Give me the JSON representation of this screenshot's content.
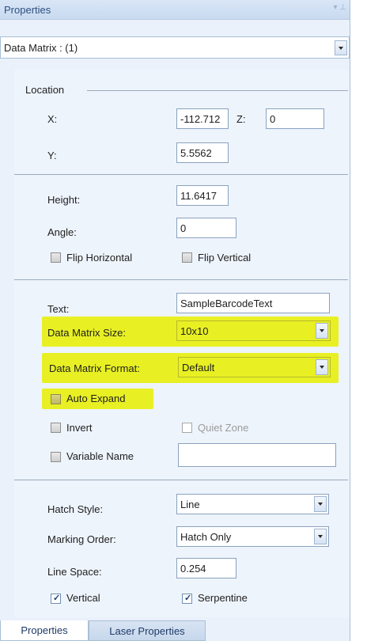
{
  "titlebar": {
    "title": "Properties",
    "pin_icon": "pin-icon"
  },
  "object_selector": {
    "value": "Data Matrix : (1)"
  },
  "location": {
    "group_label": "Location",
    "x_label": "X:",
    "x_value": "-112.712",
    "z_label": "Z:",
    "z_value": "0",
    "y_label": "Y:",
    "y_value": "5.5562"
  },
  "geometry": {
    "height_label": "Height:",
    "height_value": "11.6417",
    "angle_label": "Angle:",
    "angle_value": "0",
    "flip_horizontal": "Flip Horizontal",
    "flip_vertical": "Flip Vertical"
  },
  "barcode": {
    "text_label": "Text:",
    "text_value": "SampleBarcodeText",
    "size_label": "Data Matrix Size:",
    "size_value": "10x10",
    "format_label": "Data Matrix Format:",
    "format_value": "Default",
    "auto_expand": "Auto Expand",
    "invert": "Invert",
    "quiet_zone": "Quiet Zone",
    "variable_name": "Variable Name",
    "variable_name_value": "",
    "highlight_color": "#e8f024"
  },
  "hatch": {
    "hatch_style_label": "Hatch Style:",
    "hatch_style_value": "Line",
    "marking_order_label": "Marking Order:",
    "marking_order_value": "Hatch Only",
    "line_space_label": "Line Space:",
    "line_space_value": "0.254",
    "vertical": "Vertical",
    "vertical_checked": true,
    "serpentine": "Serpentine",
    "serpentine_checked": true
  },
  "tabs": [
    {
      "label": "Properties",
      "active": true
    },
    {
      "label": "Laser Properties",
      "active": false
    }
  ]
}
